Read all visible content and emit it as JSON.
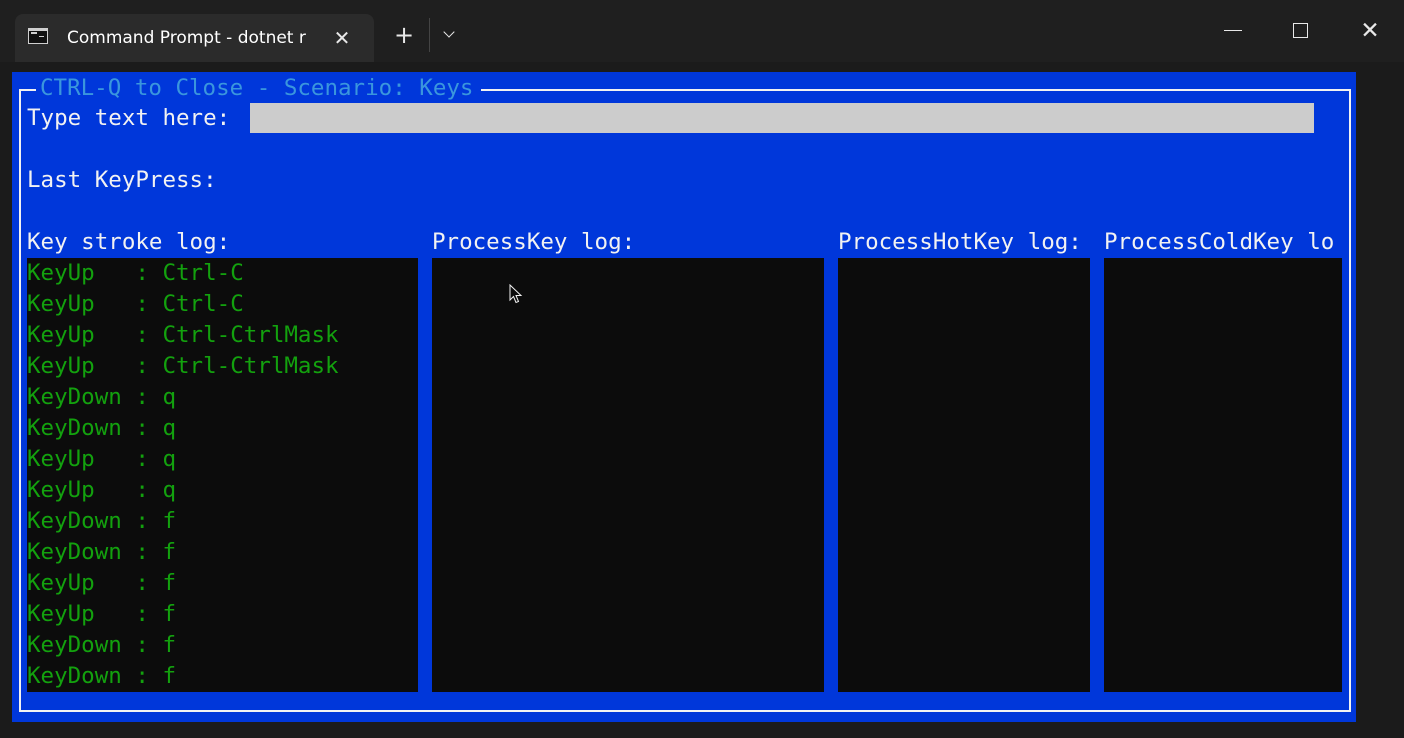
{
  "tab": {
    "title": "Command Prompt - dotnet  r",
    "icon": "terminal-icon",
    "close_glyph": "✕"
  },
  "titlebar": {
    "new_tab_glyph": "+",
    "close_glyph": "✕"
  },
  "colors": {
    "background": "#0037da",
    "title_text": "#3a96dd",
    "label_text": "#f2f2f2",
    "log_text": "#13a10e",
    "panel_bg": "#0c0c0c",
    "input_bg": "#cccccc"
  },
  "window": {
    "title": "CTRL-Q to Close - Scenario: Keys"
  },
  "input": {
    "label": "Type text here:",
    "value": ""
  },
  "last_keypress": {
    "label": "Last KeyPress:"
  },
  "logs": {
    "keystroke": {
      "label": "Key stroke log:",
      "lines": [
        "KeyUp   : Ctrl-C",
        "KeyUp   : Ctrl-C",
        "KeyUp   : Ctrl-CtrlMask",
        "KeyUp   : Ctrl-CtrlMask",
        "KeyDown : q",
        "KeyDown : q",
        "KeyUp   : q",
        "KeyUp   : q",
        "KeyDown : f",
        "KeyDown : f",
        "KeyUp   : f",
        "KeyUp   : f",
        "KeyDown : f",
        "KeyDown : f"
      ]
    },
    "processkey": {
      "label": "ProcessKey log:",
      "lines": []
    },
    "processhotkey": {
      "label": "ProcessHotKey log:",
      "lines": []
    },
    "processcoldkey": {
      "label": "ProcessColdKey lo",
      "lines": []
    }
  }
}
